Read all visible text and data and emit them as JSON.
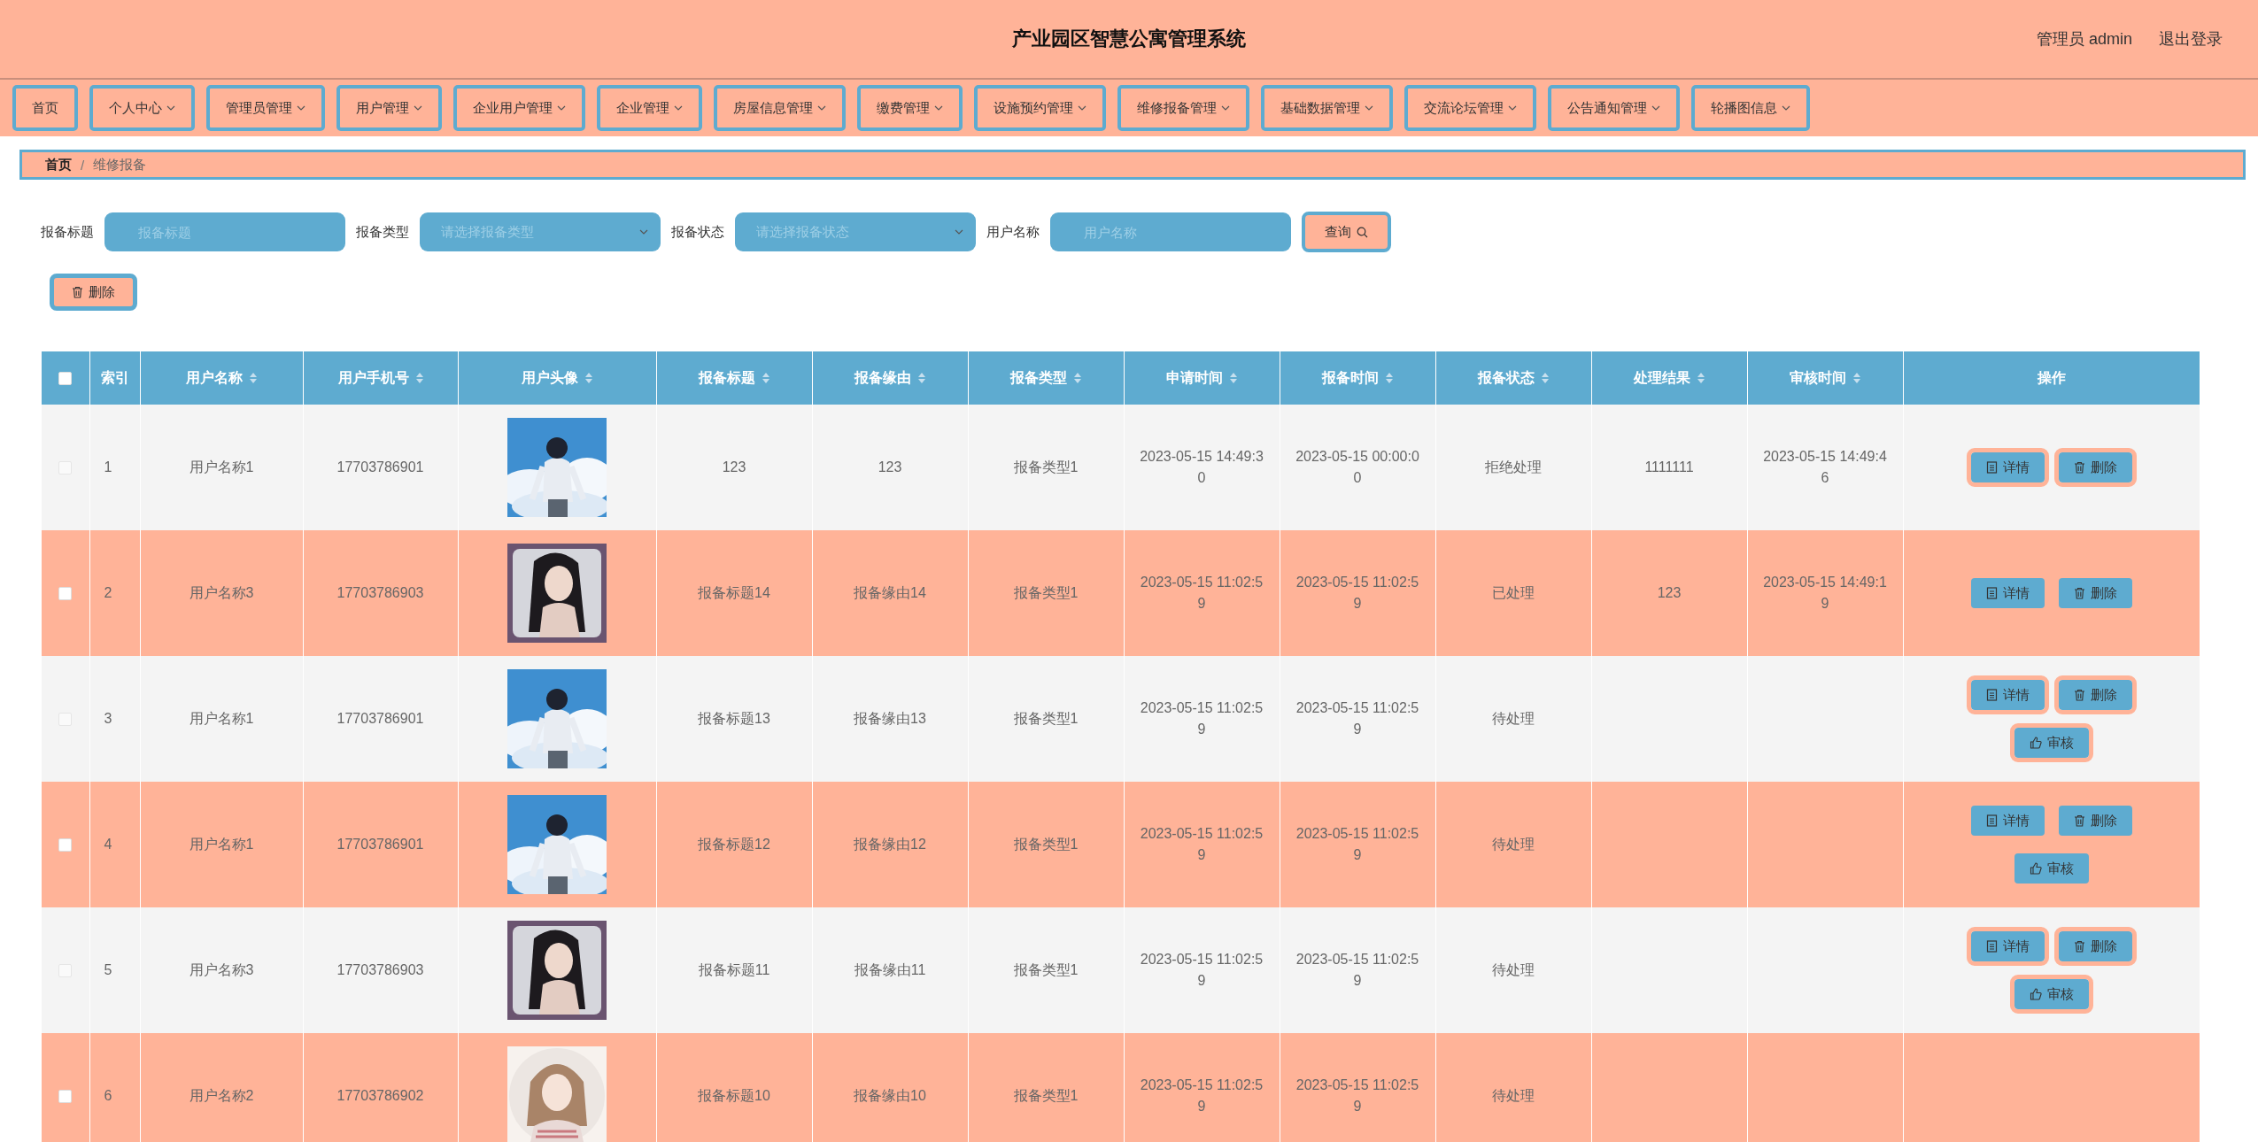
{
  "header": {
    "title": "产业园区智慧公寓管理系统",
    "user": "管理员 admin",
    "logout": "退出登录"
  },
  "nav": [
    {
      "label": "首页",
      "dropdown": false
    },
    {
      "label": "个人中心",
      "dropdown": true
    },
    {
      "label": "管理员管理",
      "dropdown": true
    },
    {
      "label": "用户管理",
      "dropdown": true
    },
    {
      "label": "企业用户管理",
      "dropdown": true
    },
    {
      "label": "企业管理",
      "dropdown": true
    },
    {
      "label": "房屋信息管理",
      "dropdown": true
    },
    {
      "label": "缴费管理",
      "dropdown": true
    },
    {
      "label": "设施预约管理",
      "dropdown": true
    },
    {
      "label": "维修报备管理",
      "dropdown": true
    },
    {
      "label": "基础数据管理",
      "dropdown": true
    },
    {
      "label": "交流论坛管理",
      "dropdown": true
    },
    {
      "label": "公告通知管理",
      "dropdown": true
    },
    {
      "label": "轮播图信息",
      "dropdown": true
    }
  ],
  "breadcrumb": {
    "home": "首页",
    "separator": "/",
    "current": "维修报备"
  },
  "filters": [
    {
      "kind": "input",
      "label": "报备标题",
      "placeholder": "报备标题"
    },
    {
      "kind": "select",
      "label": "报备类型",
      "placeholder": "请选择报备类型"
    },
    {
      "kind": "select",
      "label": "报备状态",
      "placeholder": "请选择报备状态"
    },
    {
      "kind": "input",
      "label": "用户名称",
      "placeholder": "用户名称"
    }
  ],
  "search_button": "查询",
  "bulk_delete_button": "删除",
  "table": {
    "select_all_checked": false,
    "columns": [
      {
        "label": "索引",
        "sortable": false
      },
      {
        "label": "用户名称",
        "sortable": true
      },
      {
        "label": "用户手机号",
        "sortable": true
      },
      {
        "label": "用户头像",
        "sortable": true
      },
      {
        "label": "报备标题",
        "sortable": true
      },
      {
        "label": "报备缘由",
        "sortable": true
      },
      {
        "label": "报备类型",
        "sortable": true
      },
      {
        "label": "申请时间",
        "sortable": true
      },
      {
        "label": "报备时间",
        "sortable": true
      },
      {
        "label": "报备状态",
        "sortable": true
      },
      {
        "label": "处理结果",
        "sortable": true
      },
      {
        "label": "审核时间",
        "sortable": true
      },
      {
        "label": "操作",
        "sortable": false
      }
    ],
    "rows": [
      {
        "checked": false,
        "index": "1",
        "name": "用户名称1",
        "phone": "17703786901",
        "avatar": {
          "kind": "picture"
        },
        "title": "123",
        "reason": "123",
        "type": "报备类型1",
        "apply_time": "2023-05-15 14:49:30",
        "report_time": "2023-05-15 00:00:00",
        "status": "拒绝处理",
        "result": "1111111",
        "audit_time": "2023-05-15 14:49:46",
        "actions": [
          {
            "kind": "detail",
            "label": "详情"
          },
          {
            "kind": "delete",
            "label": "删除"
          }
        ]
      },
      {
        "checked": false,
        "index": "2",
        "name": "用户名称3",
        "phone": "17703786903",
        "avatar": {
          "kind": "picture"
        },
        "title": "报备标题14",
        "reason": "报备缘由14",
        "type": "报备类型1",
        "apply_time": "2023-05-15 11:02:59",
        "report_time": "2023-05-15 11:02:59",
        "status": "已处理",
        "result": "123",
        "audit_time": "2023-05-15 14:49:19",
        "actions": [
          {
            "kind": "detail",
            "label": "详情"
          },
          {
            "kind": "delete",
            "label": "删除"
          }
        ]
      },
      {
        "checked": false,
        "index": "3",
        "name": "用户名称1",
        "phone": "17703786901",
        "avatar": {
          "kind": "picture"
        },
        "title": "报备标题13",
        "reason": "报备缘由13",
        "type": "报备类型1",
        "apply_time": "2023-05-15 11:02:59",
        "report_time": "2023-05-15 11:02:59",
        "status": "待处理",
        "actions": [
          {
            "kind": "detail",
            "label": "详情"
          },
          {
            "kind": "delete",
            "label": "删除"
          },
          {
            "kind": "audit",
            "label": "审核"
          }
        ]
      },
      {
        "checked": false,
        "index": "4",
        "name": "用户名称1",
        "phone": "17703786901",
        "avatar": {
          "kind": "picture"
        },
        "title": "报备标题12",
        "reason": "报备缘由12",
        "type": "报备类型1",
        "apply_time": "2023-05-15 11:02:59",
        "report_time": "2023-05-15 11:02:59",
        "status": "待处理",
        "actions": [
          {
            "kind": "detail",
            "label": "详情"
          },
          {
            "kind": "delete",
            "label": "删除"
          },
          {
            "kind": "audit",
            "label": "审核"
          }
        ]
      },
      {
        "checked": false,
        "index": "5",
        "name": "用户名称3",
        "phone": "17703786903",
        "avatar": {
          "kind": "picture"
        },
        "title": "报备标题11",
        "reason": "报备缘由11",
        "type": "报备类型1",
        "apply_time": "2023-05-15 11:02:59",
        "report_time": "2023-05-15 11:02:59",
        "status": "待处理",
        "actions": [
          {
            "kind": "detail",
            "label": "详情"
          },
          {
            "kind": "delete",
            "label": "删除"
          },
          {
            "kind": "audit",
            "label": "审核"
          }
        ]
      },
      {
        "checked": false,
        "index": "6",
        "name": "用户名称2",
        "phone": "17703786902",
        "avatar": {
          "kind": "picture"
        },
        "title": "报备标题10",
        "reason": "报备缘由10",
        "type": "报备类型1",
        "apply_time": "2023-05-15 11:02:59",
        "report_time": "2023-05-15 11:02:59",
        "status": "待处理"
      }
    ]
  }
}
